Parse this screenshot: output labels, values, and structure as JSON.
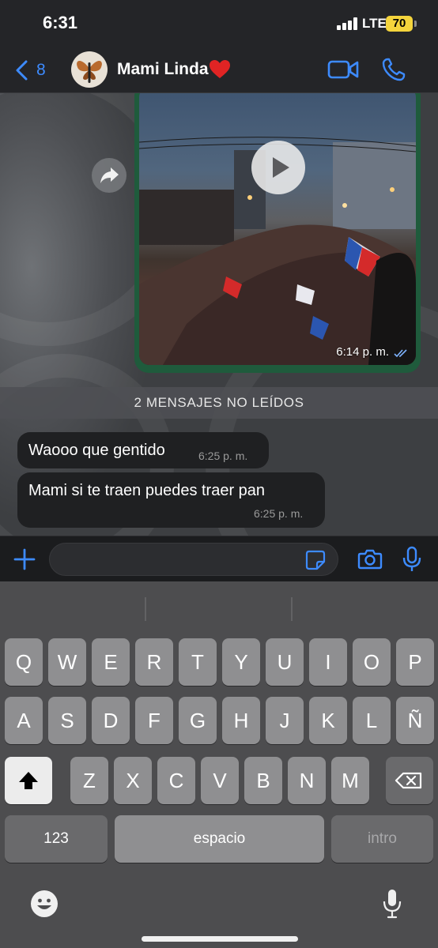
{
  "status_bar": {
    "time": "6:31",
    "network": "LTE",
    "battery": "70",
    "battery_color": "#f4d43c"
  },
  "header": {
    "back_count": "8",
    "contact_name": "Mami Linda",
    "accent_color": "#3d8bff",
    "icons": [
      "back-chevron-icon",
      "heart-icon",
      "video-call-icon",
      "phone-call-icon"
    ]
  },
  "chat": {
    "video_message": {
      "time": "6:14 p. m.",
      "status": "read",
      "bubble_color": "#1f5b3c"
    },
    "unread_divider": "2 MENSAJES NO LEÍDOS",
    "messages": [
      {
        "text": "Waooo que gentido",
        "time": "6:25 p. m."
      },
      {
        "text": "Mami si te traen puedes traer pan",
        "time": "6:25 p. m."
      }
    ]
  },
  "input_bar": {
    "placeholder": "",
    "icons": [
      "plus-icon",
      "sticker-icon",
      "camera-icon",
      "microphone-icon"
    ]
  },
  "keyboard": {
    "row1": [
      "Q",
      "W",
      "E",
      "R",
      "T",
      "Y",
      "U",
      "I",
      "O",
      "P"
    ],
    "row2": [
      "A",
      "S",
      "D",
      "F",
      "G",
      "H",
      "J",
      "K",
      "L",
      "Ñ"
    ],
    "row3": [
      "Z",
      "X",
      "C",
      "V",
      "B",
      "N",
      "M"
    ],
    "numbers_key": "123",
    "space_key": "espacio",
    "return_key": "intro"
  }
}
